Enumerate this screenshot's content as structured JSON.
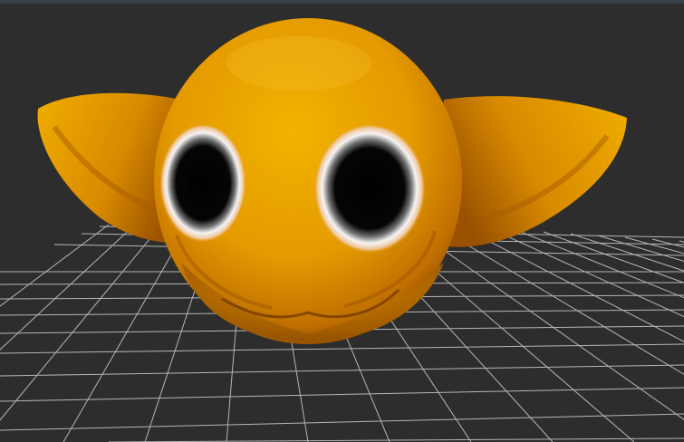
{
  "viewport": {
    "background": "#2d2d2d",
    "top_strip_color": "#3a3f45",
    "grid_color": "#d8d8d8",
    "model_color": "#e6a100",
    "model_shadow_color": "#8a4a00",
    "eye_iris_color": "#000000",
    "eye_white_color": "#ffffff"
  },
  "scene": {
    "model": "3d-sculpt-creature-head",
    "grid": "perspective-floor-grid"
  }
}
